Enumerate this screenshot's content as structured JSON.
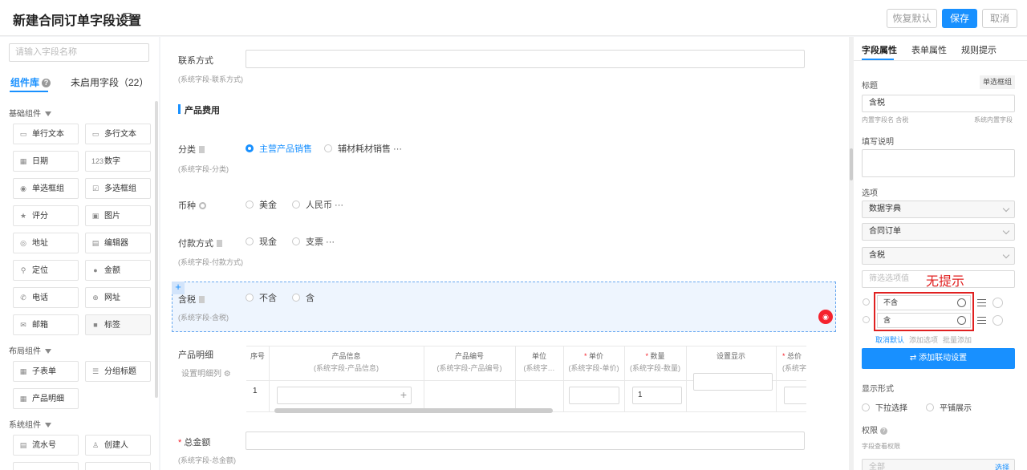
{
  "header": {
    "title": "新建合同订单字段设置",
    "buttons": {
      "restore": "恢复默认",
      "save": "保存",
      "cancel": "取消"
    }
  },
  "left": {
    "search_placeholder": "请输入字段名称",
    "tabs": [
      {
        "label": "组件库",
        "active": true
      },
      {
        "label": "未启用字段（22）"
      }
    ],
    "groups": {
      "basic": "基础组件",
      "layout": "布局组件",
      "system": "系统组件"
    },
    "basic_components": [
      {
        "label": "单行文本",
        "icon": "single-line-icon"
      },
      {
        "label": "多行文本",
        "icon": "multi-line-icon"
      },
      {
        "label": "日期",
        "icon": "calendar-icon"
      },
      {
        "label": "数字",
        "icon": "number-icon"
      },
      {
        "label": "单选框组",
        "icon": "radio-icon"
      },
      {
        "label": "多选框组",
        "icon": "checkbox-icon"
      },
      {
        "label": "评分",
        "icon": "star-icon"
      },
      {
        "label": "图片",
        "icon": "image-icon"
      },
      {
        "label": "地址",
        "icon": "location-icon"
      },
      {
        "label": "编辑器",
        "icon": "editor-icon"
      },
      {
        "label": "定位",
        "icon": "pin-icon"
      },
      {
        "label": "金额",
        "icon": "money-icon"
      },
      {
        "label": "电话",
        "icon": "phone-icon"
      },
      {
        "label": "网址",
        "icon": "globe-icon"
      },
      {
        "label": "邮箱",
        "icon": "mail-icon"
      },
      {
        "label": "标签",
        "icon": "tag-icon"
      }
    ],
    "layout_components": [
      {
        "label": "子表单",
        "icon": "table-icon"
      },
      {
        "label": "分组标题",
        "icon": "group-title-icon"
      },
      {
        "label": "产品明细",
        "icon": "product-detail-icon"
      }
    ],
    "system_components": [
      {
        "label": "流水号",
        "icon": "serial-icon"
      },
      {
        "label": "创建人",
        "icon": "user-icon"
      }
    ]
  },
  "form": {
    "contact": {
      "label": "联系方式",
      "sub": "(系统字段-联系方式)"
    },
    "section": "产品费用",
    "category": {
      "label": "分类",
      "sub": "(系统字段-分类)",
      "options": [
        "主营产品销售",
        "辅材耗材销售 ···"
      ]
    },
    "currency": {
      "label": "币种",
      "options": [
        "美金",
        "人民币 ···"
      ]
    },
    "payment": {
      "label": "付款方式",
      "sub": "(系统字段-付款方式)",
      "options": [
        "现金",
        "支票 ···"
      ]
    },
    "tax": {
      "label": "含税",
      "sub": "(系统字段-含税)",
      "options": [
        "不含",
        "含"
      ]
    },
    "product_detail": {
      "label": "产品明细",
      "setting": "设置明细列",
      "columns": [
        {
          "title": "序号",
          "sub": ""
        },
        {
          "title": "产品信息",
          "sub": "(系统字段-产品信息)"
        },
        {
          "title": "产品编号",
          "sub": "(系统字段-产品编号)"
        },
        {
          "title": "单位",
          "sub": "(系统字…"
        },
        {
          "title": "单价",
          "sub": "(系统字段-单价)",
          "required": true
        },
        {
          "title": "数量",
          "sub": "(系统字段-数量)",
          "required": true
        },
        {
          "title": "设置显示",
          "sub": ""
        },
        {
          "title": "总价",
          "sub": "(系统字…",
          "required": true
        }
      ],
      "row_index": "1",
      "quantity_value": "1"
    },
    "total": {
      "label": "总金额",
      "sub": "(系统字段-总金额)",
      "required_mark": "*"
    }
  },
  "right": {
    "tabs": [
      {
        "label": "字段属性",
        "active": true
      },
      {
        "label": "表单属性"
      },
      {
        "label": "规则提示"
      }
    ],
    "title_label": "标题",
    "type_badge": "单选框组",
    "title_value": "含税",
    "internal_name": "内置字段名 含税",
    "internal_type": "系统内置字段",
    "desc_label": "填写说明",
    "options_label": "选项",
    "select1": "数据字典",
    "select2": "合同订单",
    "select3": "含税",
    "filter_placeholder": "筛选选项值",
    "annotation": "无提示",
    "option_items": [
      "不含",
      "含"
    ],
    "links": [
      "取消默认",
      "添加选项",
      "批量添加"
    ],
    "linkage_button": "添加联动设置",
    "display_label": "显示形式",
    "display_options": [
      "下拉选择",
      "平铺展示"
    ],
    "permission_label": "权限",
    "permission_sub": "字段查看权限",
    "permission_value": "全部",
    "permission_select": "选择"
  }
}
